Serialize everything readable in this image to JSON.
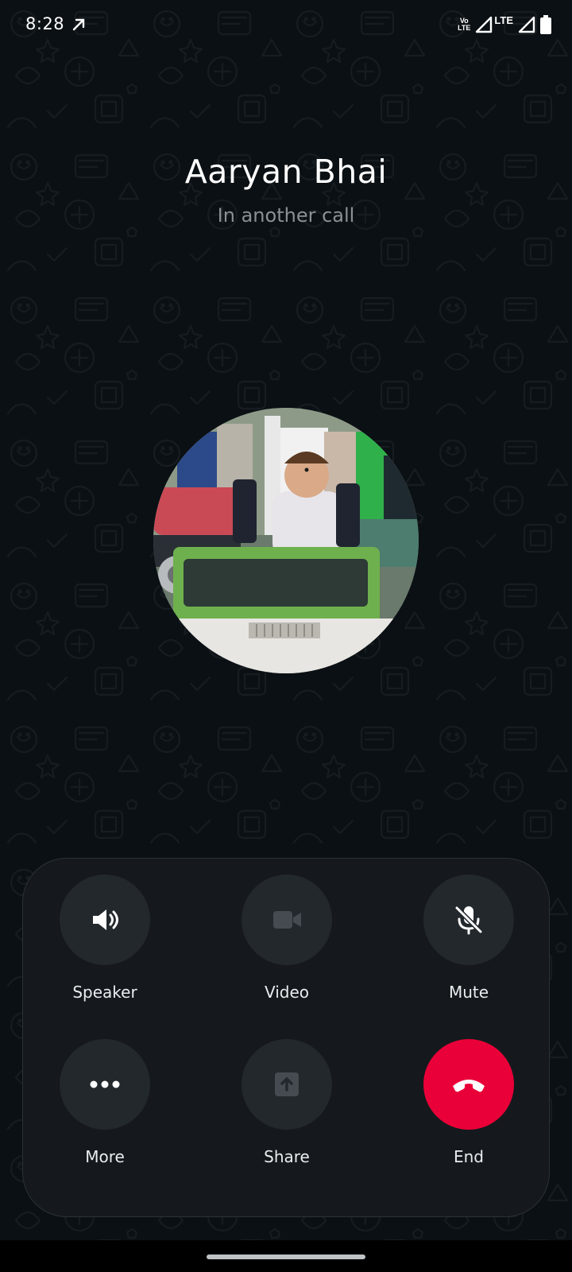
{
  "status_bar": {
    "time": "8:28",
    "volte_top": "Vo",
    "volte_bottom": "LTE",
    "network_type": "LTE"
  },
  "call": {
    "contact_name": "Aaryan Bhai",
    "status": "In another call"
  },
  "controls": {
    "speaker_label": "Speaker",
    "video_label": "Video",
    "mute_label": "Mute",
    "more_label": "More",
    "share_label": "Share",
    "end_label": "End"
  },
  "colors": {
    "background": "#0b1014",
    "panel": "#15191d",
    "button": "#23282c",
    "end_button": "#ea0038",
    "subtle_text": "#8a9196"
  },
  "icons": {
    "speaker": "speaker-icon",
    "video": "video-camera-icon",
    "mute": "microphone-off-icon",
    "more": "more-dots-icon",
    "share": "share-upload-icon",
    "end": "phone-hangup-icon"
  }
}
